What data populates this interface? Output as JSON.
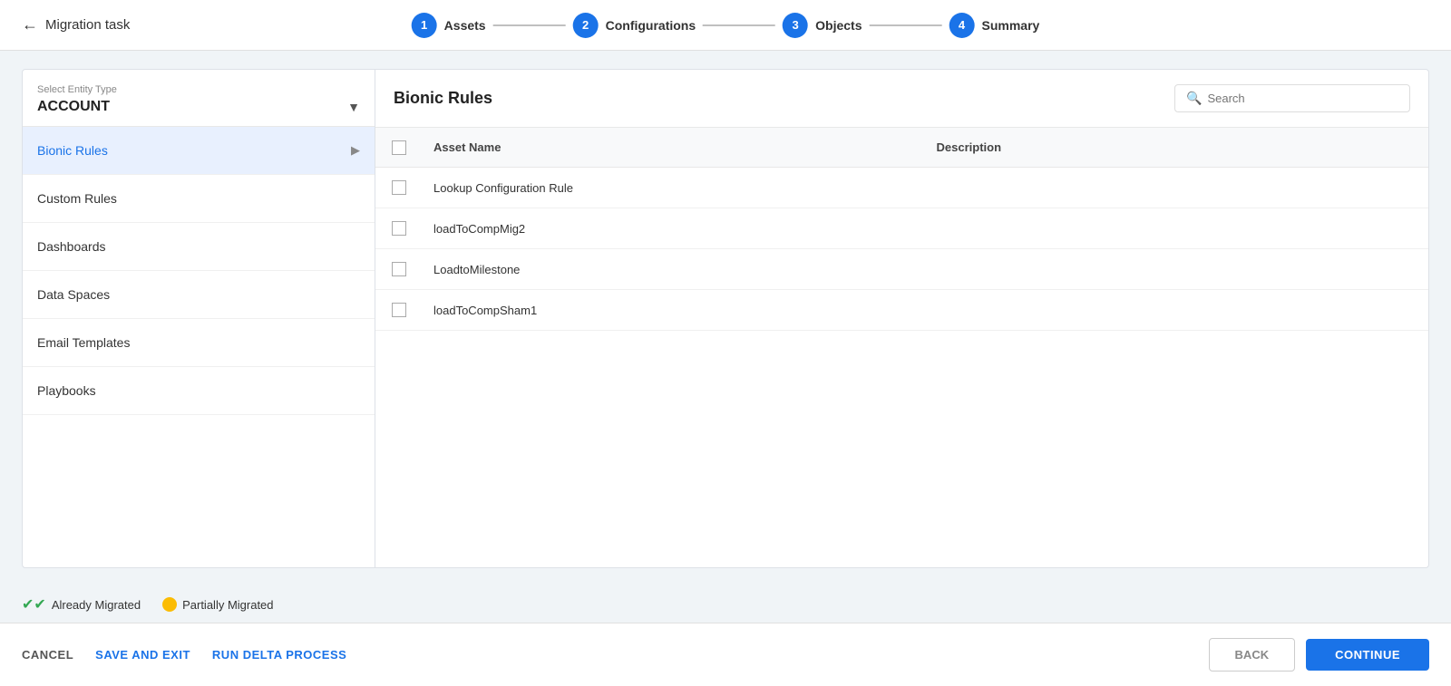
{
  "topBar": {
    "backLabel": "Migration task",
    "steps": [
      {
        "number": "1",
        "label": "Assets",
        "active": true
      },
      {
        "number": "2",
        "label": "Configurations",
        "active": false
      },
      {
        "number": "3",
        "label": "Objects",
        "active": false
      },
      {
        "number": "4",
        "label": "Summary",
        "active": false
      }
    ]
  },
  "leftPanel": {
    "entityTypeLabel": "Select Entity Type",
    "entityTypeValue": "ACCOUNT",
    "sidebarItems": [
      {
        "id": "bionic-rules",
        "label": "Bionic Rules",
        "active": true,
        "hasArrow": true
      },
      {
        "id": "custom-rules",
        "label": "Custom Rules",
        "active": false,
        "hasArrow": false
      },
      {
        "id": "dashboards",
        "label": "Dashboards",
        "active": false,
        "hasArrow": false
      },
      {
        "id": "data-spaces",
        "label": "Data Spaces",
        "active": false,
        "hasArrow": false
      },
      {
        "id": "email-templates",
        "label": "Email Templates",
        "active": false,
        "hasArrow": false
      },
      {
        "id": "playbooks",
        "label": "Playbooks",
        "active": false,
        "hasArrow": false
      }
    ]
  },
  "rightPanel": {
    "title": "Bionic Rules",
    "searchPlaceholder": "Search",
    "columns": [
      "Asset Name",
      "Description"
    ],
    "rows": [
      {
        "id": 1,
        "assetName": "Lookup Configuration Rule",
        "description": "",
        "checked": false
      },
      {
        "id": 2,
        "assetName": "loadToCompMig2",
        "description": "",
        "checked": false
      },
      {
        "id": 3,
        "assetName": "LoadtoMilestone",
        "description": "",
        "checked": false
      },
      {
        "id": 4,
        "assetName": "loadToCompSham1",
        "description": "",
        "checked": false
      }
    ]
  },
  "legend": {
    "alreadyMigrated": "Already Migrated",
    "partiallyMigrated": "Partially Migrated"
  },
  "bottomBar": {
    "cancelLabel": "CANCEL",
    "saveAndExitLabel": "SAVE AND EXIT",
    "runDeltaLabel": "RUN DELTA PROCESS",
    "backLabel": "BACK",
    "continueLabel": "CONTINUE"
  }
}
